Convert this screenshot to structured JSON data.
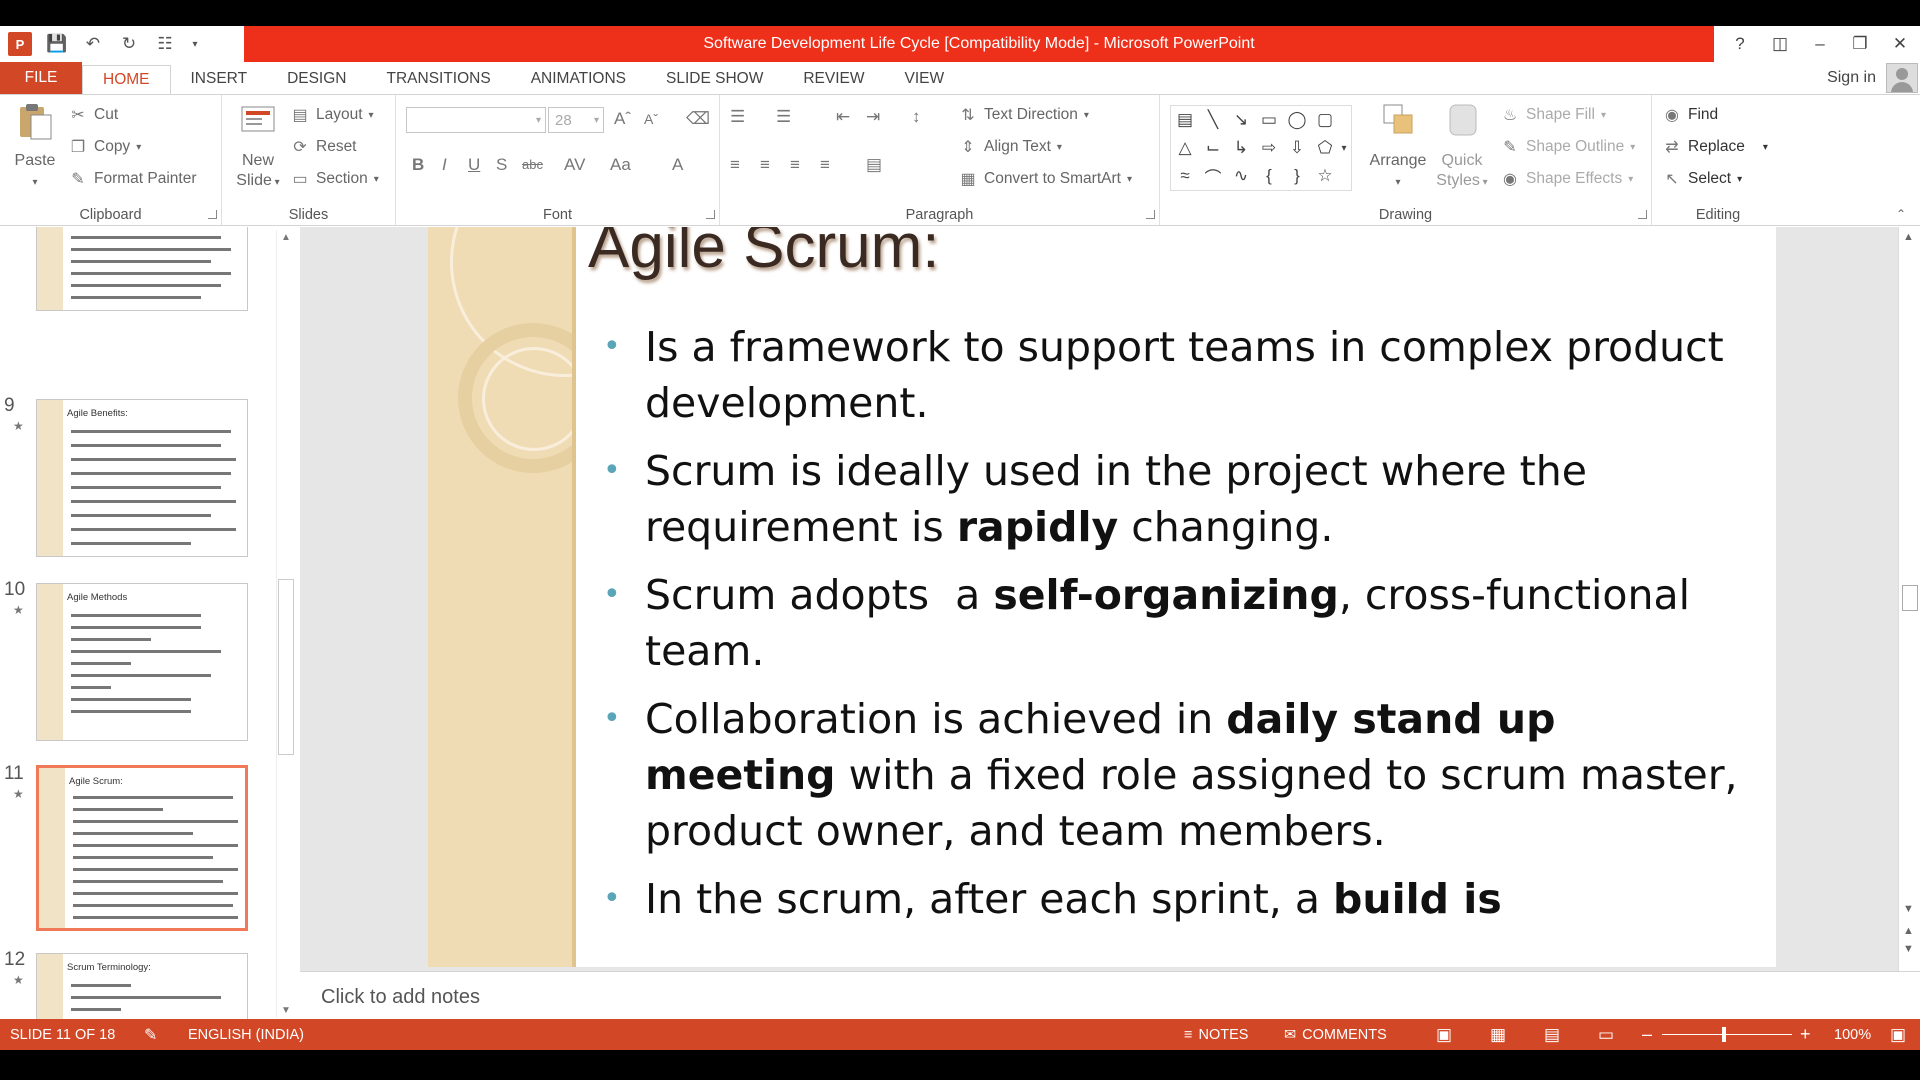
{
  "window": {
    "title": "Software Development Life Cycle [Compatibility Mode] -  Microsoft PowerPoint"
  },
  "tabs": [
    "FILE",
    "HOME",
    "INSERT",
    "DESIGN",
    "TRANSITIONS",
    "ANIMATIONS",
    "SLIDE SHOW",
    "REVIEW",
    "VIEW"
  ],
  "account": {
    "signin": "Sign in"
  },
  "ribbon": {
    "clipboard": {
      "label": "Clipboard",
      "paste": "Paste",
      "cut": "Cut",
      "copy": "Copy",
      "format_painter": "Format Painter"
    },
    "slides": {
      "label": "Slides",
      "new_slide_1": "New",
      "new_slide_2": "Slide",
      "layout": "Layout",
      "reset": "Reset",
      "section": "Section"
    },
    "font": {
      "label": "Font",
      "size": "28"
    },
    "paragraph": {
      "label": "Paragraph",
      "text_direction": "Text Direction",
      "align_text": "Align Text",
      "convert_smartart": "Convert to SmartArt"
    },
    "drawing": {
      "label": "Drawing",
      "arrange": "Arrange",
      "quick_1": "Quick",
      "quick_2": "Styles",
      "shape_fill": "Shape Fill",
      "shape_outline": "Shape Outline",
      "shape_effects": "Shape Effects"
    },
    "editing": {
      "label": "Editing",
      "find": "Find",
      "replace": "Replace",
      "select": "Select"
    }
  },
  "thumbnails": [
    {
      "number": "9",
      "title": "Agile Benefits:"
    },
    {
      "number": "10",
      "title": "Agile Methods"
    },
    {
      "number": "11",
      "title": "Agile Scrum:"
    },
    {
      "number": "12",
      "title": "Scrum Terminology:"
    }
  ],
  "slide": {
    "title": "Agile Scrum:",
    "b1": "Is a framework to support teams in complex product development.",
    "b2_pre": "Scrum is ideally used in the project where the requirement is ",
    "b2_bold": "rapidly",
    "b2_post": " changing.",
    "b3_pre": "Scrum adopts  a ",
    "b3_bold": "self-organizing",
    "b3_post": ", cross-functional team.",
    "b4_pre": "Collaboration is achieved in ",
    "b4_bold": "daily stand up meeting",
    "b4_post": " with a fixed role assigned to scrum master, product owner, and team members.",
    "b5_pre": "In the scrum, after each sprint, a ",
    "b5_bold": "build is"
  },
  "notes_placeholder": "Click to add notes",
  "status": {
    "slide": "SLIDE 11 OF 18",
    "language": "ENGLISH (INDIA)",
    "notes": "NOTES",
    "comments": "COMMENTS",
    "zoom": "100%"
  }
}
